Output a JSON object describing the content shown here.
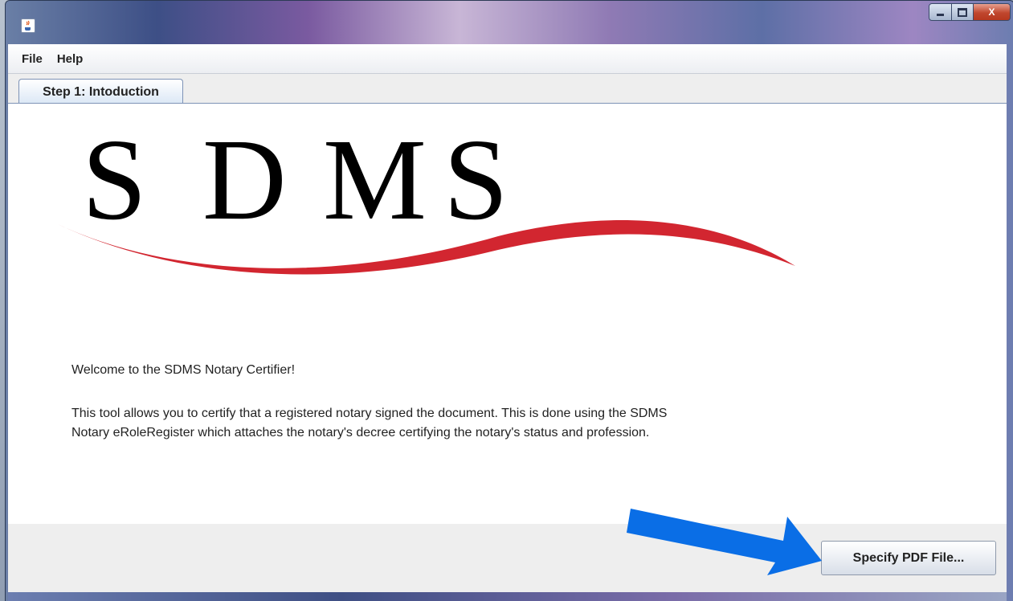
{
  "window": {
    "icon": "java-coffee-cup-icon",
    "controls": {
      "minimize": "minimize-icon",
      "maximize": "maximize-icon",
      "close_label": "X"
    }
  },
  "menubar": {
    "items": [
      {
        "label": "File"
      },
      {
        "label": "Help"
      }
    ]
  },
  "tabs": [
    {
      "label": "Step 1: Intoduction",
      "selected": true
    }
  ],
  "logo": {
    "letters": [
      "S",
      "D",
      "M",
      "S"
    ],
    "swoosh_color": "#d22630"
  },
  "content": {
    "welcome": "Welcome to the SDMS Notary Certifier!",
    "description_lines": [
      "This tool allows you to certify that a registered notary signed the document. This is done using the SDMS",
      "Notary eRoleRegister which attaches the notary's decree certifying the notary's status and profession."
    ]
  },
  "footer": {
    "specify_button": "Specify PDF File..."
  },
  "annotation": {
    "arrow_color": "#0a6ee6",
    "arrow_icon": "blue-arrow-icon"
  }
}
